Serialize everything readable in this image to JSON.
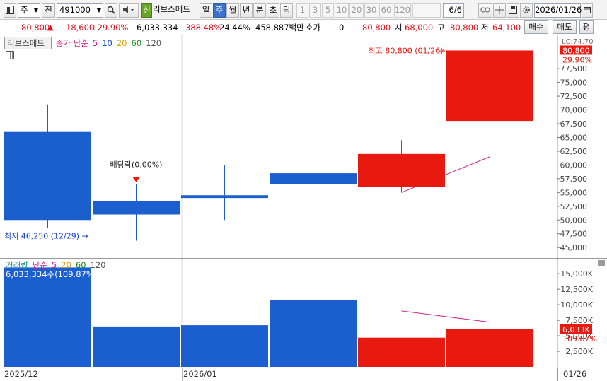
{
  "toolbar": {
    "market": "주",
    "market_flag": "전",
    "code": "491000",
    "new_badge": "신",
    "stock_name": "리브스메드",
    "periods": [
      "일",
      "주",
      "월",
      "년",
      "분",
      "초",
      "틱"
    ],
    "active_period": "주",
    "minute_options": [
      "1",
      "3",
      "5",
      "10",
      "20",
      "30",
      "60",
      "120"
    ],
    "count": "6",
    "count_total": "/6",
    "date": "2026/01/26"
  },
  "quote": {
    "price": "80,800",
    "change": "18,600",
    "change_pct": "+29.90%",
    "volume": "6,033,334",
    "volume_ratio": "388.48%",
    "turnover": "24.44%",
    "amount": "458,887백만",
    "hoga_label": "호가",
    "hoga_value": "0",
    "hoga_price": "80,800",
    "open_label": "시",
    "open": "68,000",
    "high_label": "고",
    "high": "80,800",
    "low_label": "저",
    "low": "64,100",
    "buy_label": "매수",
    "sell_label": "매도",
    "eval_label": "평"
  },
  "price_panel": {
    "name": "리브스메드",
    "ma_label": "종가 단순",
    "ma_periods": [
      "5",
      "10",
      "20",
      "60",
      "120"
    ],
    "ma_colors": [
      "#d0208a",
      "#1a3fd0",
      "#e0a000",
      "#1f8a1f",
      "#555555"
    ],
    "axis_ticks": [
      "77,500",
      "75,000",
      "72,500",
      "70,000",
      "67,500",
      "65,000",
      "62,500",
      "60,000",
      "57,500",
      "55,000",
      "52,500",
      "50,000",
      "47,500",
      "45,000"
    ],
    "current_price_tag": "80,800",
    "current_pct_tag": "29.90%",
    "top_partial_tick": "LC:74.70",
    "max_label": "최고 80,800 (01/26)",
    "min_label": "최저 46,250 (12/29)",
    "dividend_label": "배당락(0.00%)"
  },
  "volume_panel": {
    "name": "거래량",
    "ma_label": "단순",
    "ma_periods": [
      "5",
      "20",
      "60",
      "120"
    ],
    "ma_colors": [
      "#d0208a",
      "#e0a000",
      "#1f8a1f",
      "#555555"
    ],
    "axis_ticks": [
      "15,000K",
      "12,500K",
      "10,000K",
      "7,500K",
      "5,000K",
      "2,500K"
    ],
    "current_tag": "6,033K",
    "current_pct": "109.87%",
    "overlay_label": "6,033,334주(109.87%)"
  },
  "x_axis": {
    "labels": [
      "2025/12",
      "2026/01"
    ],
    "right_label": "01/26"
  },
  "chart_data": {
    "type": "candlestick",
    "period": "weekly",
    "candles": [
      {
        "open": 66000,
        "high": 71000,
        "low": 48500,
        "close": 50000,
        "volume": 16000000
      },
      {
        "open": 53500,
        "high": 56500,
        "low": 46250,
        "close": 51000,
        "volume": 6500000
      },
      {
        "open": 54500,
        "high": 60000,
        "low": 50000,
        "close": 54000,
        "volume": 6700000
      },
      {
        "open": 58500,
        "high": 66000,
        "low": 53500,
        "close": 56500,
        "volume": 10800000
      },
      {
        "open": 56000,
        "high": 64500,
        "low": 55000,
        "close": 62000,
        "volume": 4700000
      },
      {
        "open": 68000,
        "high": 80800,
        "low": 64100,
        "close": 80800,
        "volume": 6033334
      }
    ],
    "ma5_price": [
      null,
      null,
      null,
      null,
      55000,
      61500
    ],
    "ma5_volume": [
      null,
      null,
      null,
      null,
      9000000,
      7200000
    ],
    "price_range": [
      44000,
      81500
    ],
    "volume_range": [
      0,
      16500000
    ],
    "colors": {
      "up": "#e8190f",
      "down": "#1b5fcf",
      "ma5": "#d0208a"
    }
  }
}
